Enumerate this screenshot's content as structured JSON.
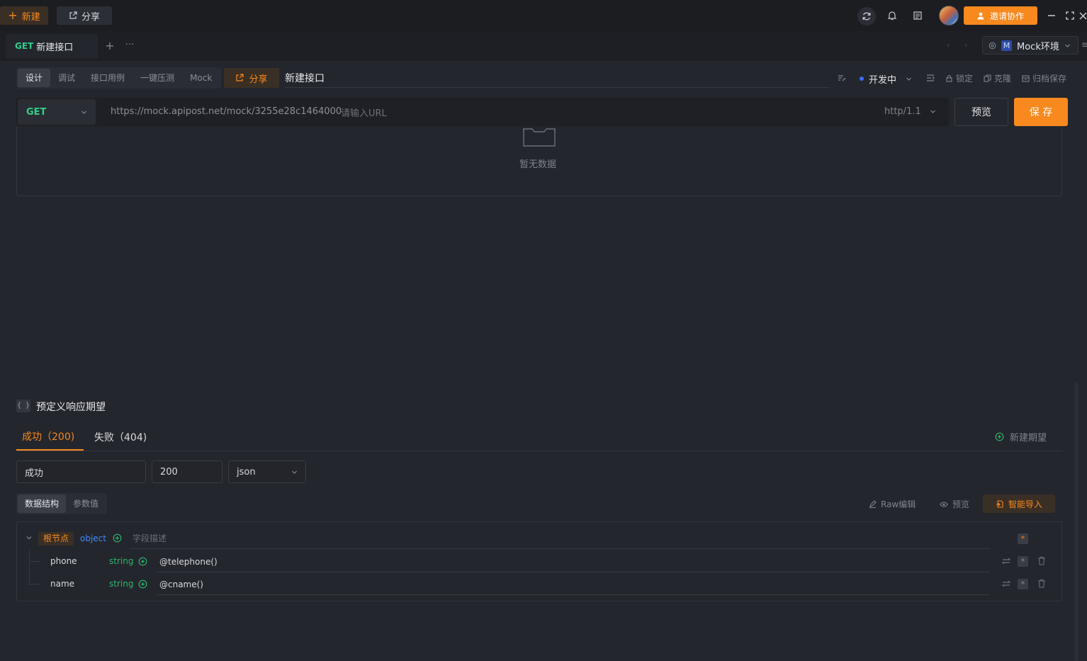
{
  "topbar": {
    "new_label": "新建",
    "share_label": "分享",
    "invite_label": "邀请协作",
    "icons": [
      "refresh-icon",
      "bell-icon",
      "document-icon",
      "avatar",
      "minimize-icon",
      "maximize-icon",
      "close-icon"
    ]
  },
  "tabs": {
    "active_method": "GET",
    "active_title": "新建接口",
    "env_badge": "M",
    "env_label": "Mock环境"
  },
  "toolbar": {
    "segments": [
      "设计",
      "调试",
      "接口用例",
      "一键压测",
      "Mock"
    ],
    "share_label": "分享",
    "name_value": "新建接口",
    "status_label": "开发中",
    "lock_label": "锁定",
    "clone_label": "克隆",
    "archive_label": "归档保存"
  },
  "url": {
    "method": "GET",
    "prefix": "https://mock.apipost.net/mock/3255e28c1464000",
    "placeholder": "请输入URL",
    "protocol": "http/1.1",
    "preview_label": "预览",
    "save_label": "保 存"
  },
  "empty": {
    "text": "暂无数据"
  },
  "expect": {
    "section_title": "预定义响应期望",
    "tabs": [
      "成功（200)",
      "失败（404)"
    ],
    "new_label": "新建期望",
    "name_value": "成功",
    "code_value": "200",
    "type_value": "json"
  },
  "schema": {
    "tabs": [
      "数据结构",
      "参数值"
    ],
    "raw_label": "Raw编辑",
    "preview_label": "预览",
    "import_label": "智能导入",
    "root_label": "根节点",
    "root_type": "object",
    "root_desc_placeholder": "字段描述",
    "rows": [
      {
        "name": "phone",
        "type": "string",
        "value": "@telephone()"
      },
      {
        "name": "name",
        "type": "string",
        "value": "@cname()"
      }
    ]
  },
  "colors": {
    "accent": "#f7891e",
    "get": "#2fcf8b",
    "type_blue": "#3d8bff",
    "type_green": "#2fb56e"
  }
}
